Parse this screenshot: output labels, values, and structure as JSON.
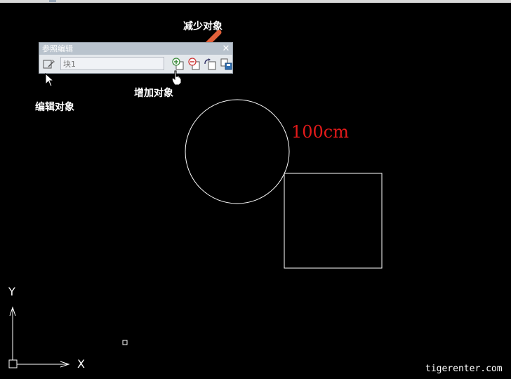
{
  "toolbar": {
    "title": "参照编辑",
    "close_glyph": "✕",
    "block_name": "块1",
    "buttons": [
      {
        "icon": "edit-reference-icon"
      },
      {
        "icon": "add-to-workset-icon"
      },
      {
        "icon": "remove-from-workset-icon"
      },
      {
        "icon": "discard-changes-icon"
      },
      {
        "icon": "save-changes-icon"
      }
    ]
  },
  "annotations": {
    "remove_objects": "减少对象",
    "add_objects": "增加对象",
    "edit_objects": "编辑对象"
  },
  "drawing": {
    "dimension_text": "100cm",
    "axis_y": "Y",
    "axis_x": "X"
  },
  "watermark": "tigerenter.com",
  "colors": {
    "background": "#000000",
    "arrow": "#e0603a",
    "dimension": "#e41a1a",
    "toolbar_title_bar": "#b9c3cd"
  }
}
